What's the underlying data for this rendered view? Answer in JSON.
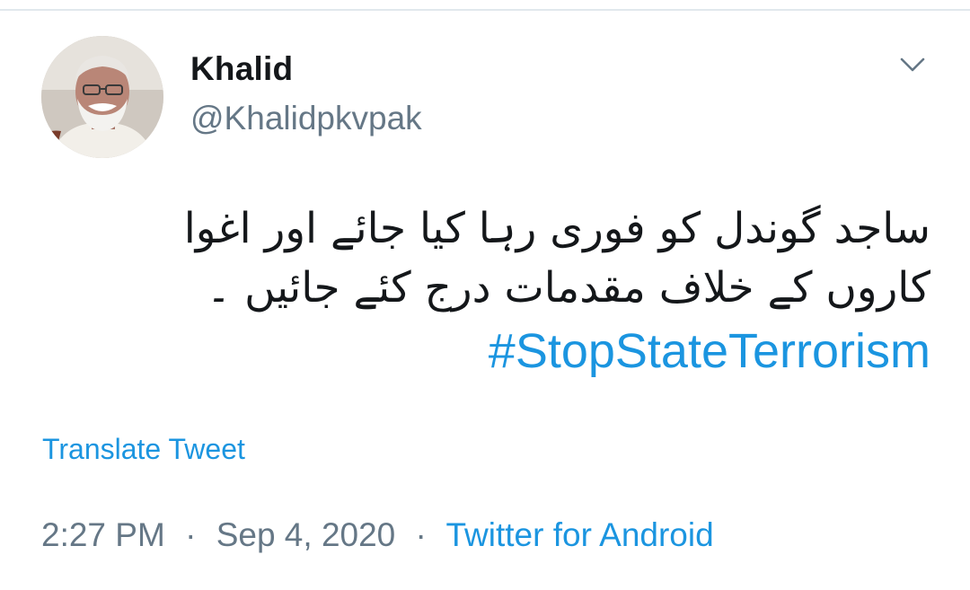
{
  "author": {
    "name": "Khalid",
    "handle": "@Khalidpkvpak"
  },
  "tweet": {
    "text_lines": [
      "ساجد گوندل  کو فوری رہا کیا جائے اور اغوا",
      "کاروں  کے خلاف  مقدمات درج  کئے جائیں ۔"
    ],
    "hashtag": "#StopStateTerrorism",
    "translate_label": "Translate Tweet"
  },
  "meta": {
    "time": "2:27 PM",
    "separator": "·",
    "date": "Sep 4, 2020",
    "source": "Twitter for Android"
  },
  "icons": {
    "caret": "chevron-down-icon",
    "avatar": "profile-photo"
  },
  "colors": {
    "text": "#14171a",
    "secondary": "#657786",
    "link": "#1b95e0",
    "divider": "#e1e8ed"
  }
}
